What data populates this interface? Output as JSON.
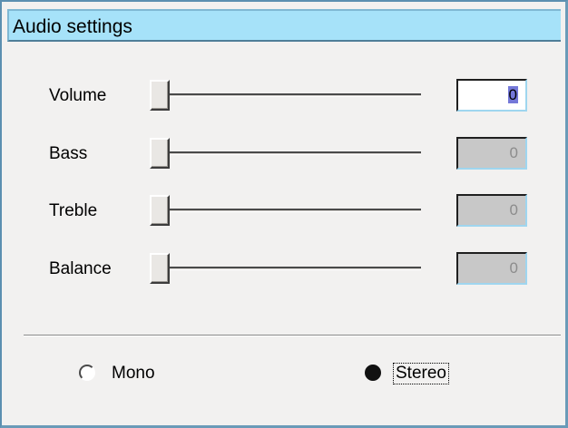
{
  "window": {
    "title": "Audio settings"
  },
  "sliders": [
    {
      "label": "Volume",
      "value": "0",
      "slider_level": 0,
      "enabled": true
    },
    {
      "label": "Bass",
      "value": "0",
      "slider_level": 0,
      "enabled": false
    },
    {
      "label": "Treble",
      "value": "0",
      "slider_level": 0,
      "enabled": false
    },
    {
      "label": "Balance",
      "value": "0",
      "slider_level": 0,
      "enabled": false
    }
  ],
  "channel_mode": {
    "options": [
      {
        "label": "Mono",
        "checked": false
      },
      {
        "label": "Stereo",
        "checked": true
      }
    ]
  },
  "colors": {
    "title_bar": "#a6e2f9",
    "disabled_field": "#c8c8c8",
    "selection": "#7478d8"
  }
}
